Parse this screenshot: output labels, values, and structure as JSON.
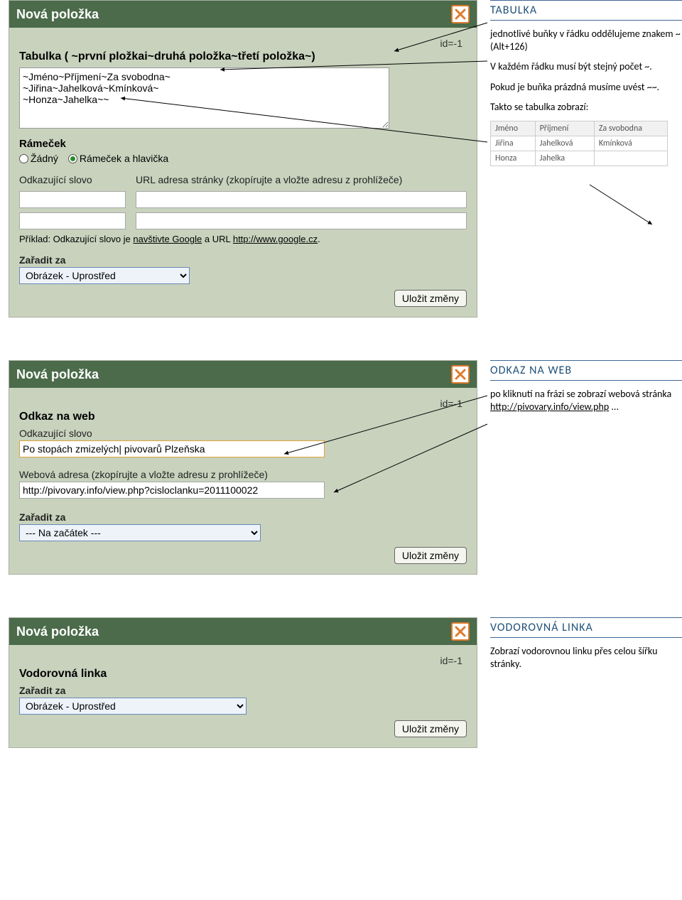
{
  "panel1": {
    "header_title": "Nová položka",
    "id_label": "id=-1",
    "section_title": "Tabulka ( ~první pložkai~druhá položka~třetí položka~)",
    "textarea_value": "~Jméno~Příjmení~Za svobodna~\n~Jiřina~Jahelková~Kmínková~\n~Honza~Jahelka~~",
    "frame_title": "Rámeček",
    "radio_none": "Žádný",
    "radio_framehdr": "Rámeček a hlavička",
    "link_word_label": "Odkazující slovo",
    "url_label": "URL adresa stránky (zkopírujte a vložte adresu z prohlížeče)",
    "hint_prefix": "Příklad: Odkazující slovo je ",
    "hint_link1": "navštivte Google",
    "hint_mid": " a URL ",
    "hint_link2": "http://www.google.cz",
    "hint_suffix": ".",
    "place_label": "Zařadit za",
    "place_value": "Obrázek - Uprostřed",
    "save_label": "Uložit změny"
  },
  "side1": {
    "title": "TABULKA",
    "p1": "jednotlivé buňky v řádku oddělujeme znakem ~ (Alt+126)",
    "p2": "V každém řádku musí být stejný počet ~.",
    "p3": "Pokud je buňka prázdná musíme uvést ~~.",
    "p4": "Takto se tabulka zobrazí:",
    "table": {
      "headers": [
        "Jméno",
        "Příjmení",
        "Za svobodna"
      ],
      "rows": [
        [
          "Jiřina",
          "Jahelková",
          "Kmínková"
        ],
        [
          "Honza",
          "Jahelka",
          ""
        ]
      ]
    }
  },
  "panel2": {
    "header_title": "Nová položka",
    "id_label": "id=-1",
    "section_title": "Odkaz na web",
    "link_word_label": "Odkazující slovo",
    "link_word_value": "Po stopách zmizelých| pivovarů Plzeňska",
    "url_label": "Webová adresa (zkopírujte a vložte adresu z prohlížeče)",
    "url_value": "http://pivovary.info/view.php?cisloclanku=2011100022",
    "place_label": "Zařadit za",
    "place_value": "--- Na začátek ---",
    "save_label": "Uložit změny"
  },
  "side2": {
    "title": "ODKAZ NA WEB",
    "p1a": "po kliknutí na frázi se zobrazí webová stránka ",
    "p1link": "http://pivovary.info/view.php",
    "p1b": " ..."
  },
  "panel3": {
    "header_title": "Nová položka",
    "id_label": "id=-1",
    "section_title": "Vodorovná linka",
    "place_label": "Zařadit za",
    "place_value": "Obrázek - Uprostřed",
    "save_label": "Uložit změny"
  },
  "side3": {
    "title": "VODOROVNÁ LINKA",
    "p1": "Zobrazí vodorovnou linku přes celou šířku stránky."
  }
}
